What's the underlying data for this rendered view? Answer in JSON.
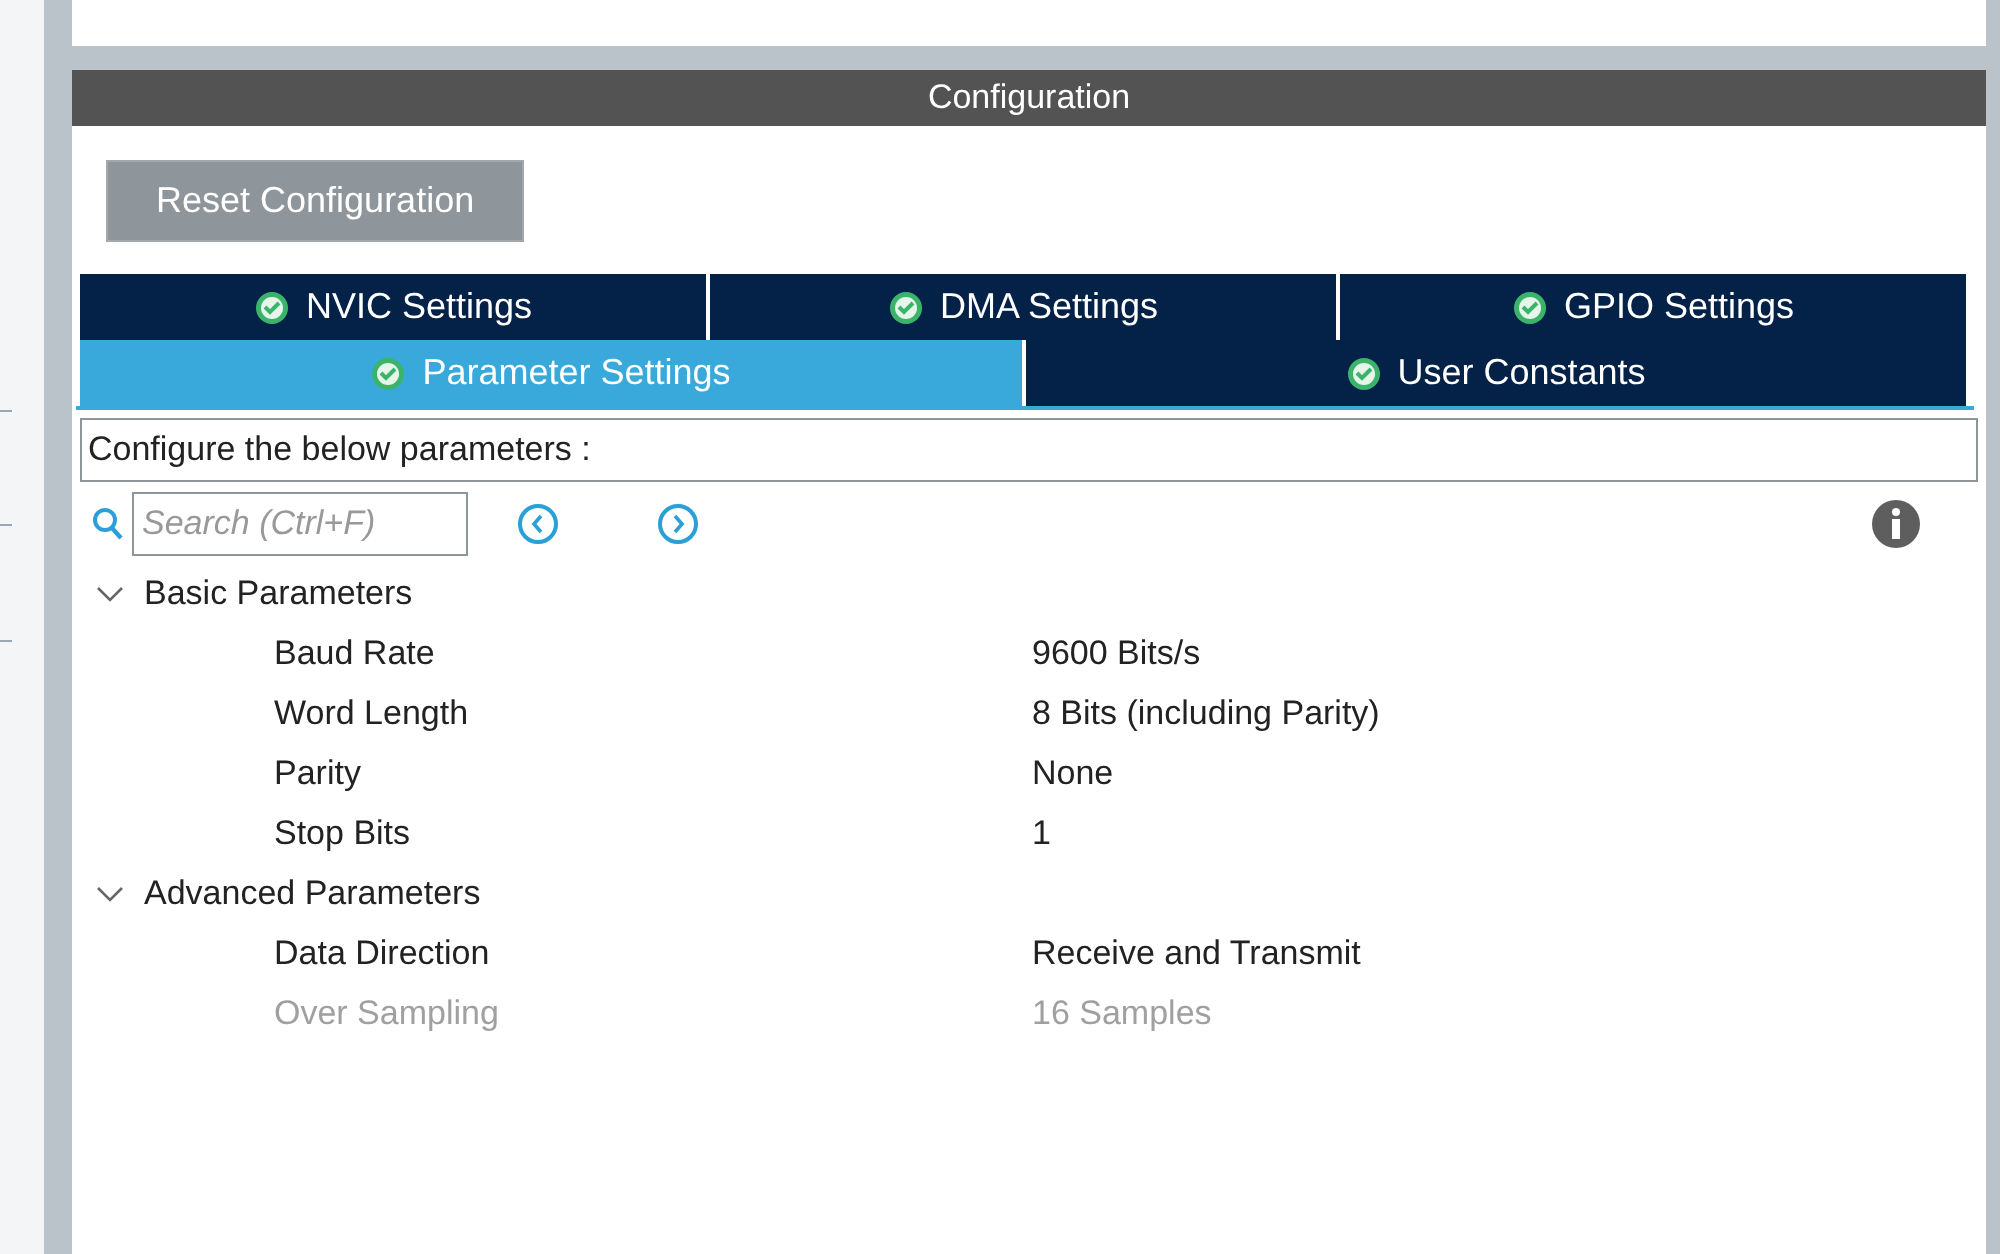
{
  "panel": {
    "title": "Configuration"
  },
  "reset_button": "Reset Configuration",
  "tab_rows": [
    {
      "tabs": [
        {
          "label": "NVIC Settings",
          "selected": false
        },
        {
          "label": "DMA Settings",
          "selected": false
        },
        {
          "label": "GPIO Settings",
          "selected": false
        }
      ]
    },
    {
      "tabs": [
        {
          "label": "Parameter Settings",
          "selected": true
        },
        {
          "label": "User Constants",
          "selected": false
        }
      ]
    }
  ],
  "description": "Configure the below parameters :",
  "search": {
    "placeholder": "Search (Ctrl+F)"
  },
  "groups": [
    {
      "label": "Basic Parameters",
      "expanded": true,
      "children": [
        {
          "name": "Baud Rate",
          "value": "9600 Bits/s",
          "disabled": false
        },
        {
          "name": "Word Length",
          "value": "8 Bits (including Parity)",
          "disabled": false
        },
        {
          "name": "Parity",
          "value": "None",
          "disabled": false
        },
        {
          "name": "Stop Bits",
          "value": "1",
          "disabled": false
        }
      ]
    },
    {
      "label": "Advanced Parameters",
      "expanded": true,
      "children": [
        {
          "name": "Data Direction",
          "value": "Receive and Transmit",
          "disabled": false
        },
        {
          "name": "Over Sampling",
          "value": "16 Samples",
          "disabled": true
        }
      ]
    }
  ]
}
